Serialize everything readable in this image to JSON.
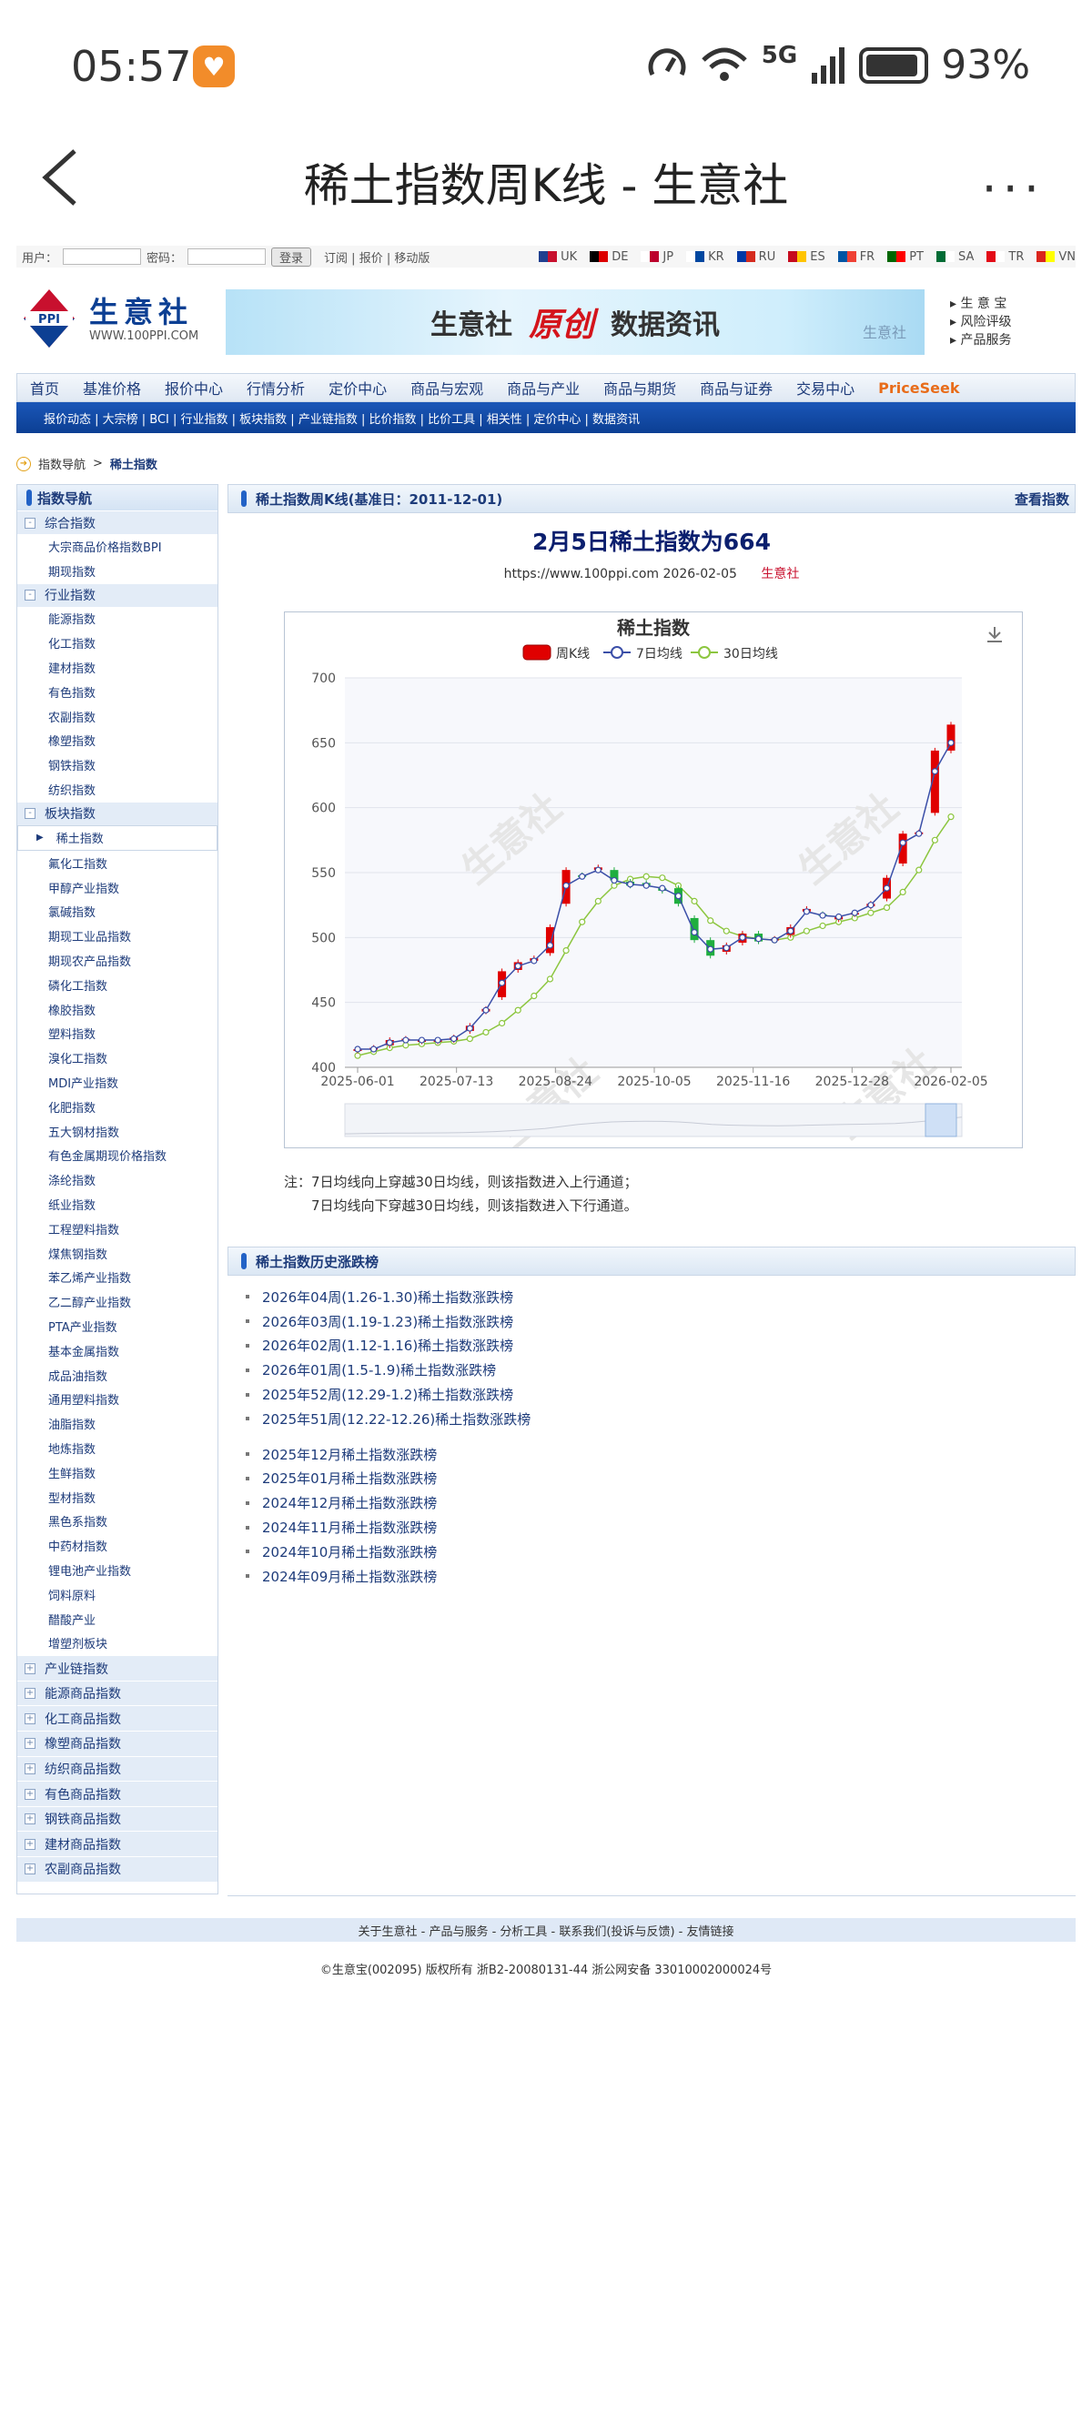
{
  "status": {
    "time": "05:57",
    "network": "5G",
    "battery": "93%"
  },
  "nav": {
    "title": "稀土指数周K线 - 生意社",
    "more": "···"
  },
  "site": {
    "top": {
      "user_label": "用户：",
      "pass_label": "密码：",
      "login": "登录",
      "links": "订阅 | 报价 | 移动版",
      "langs": [
        {
          "code": "UK",
          "c1": "#1f3f8f",
          "c2": "#c8102e"
        },
        {
          "code": "DE",
          "c1": "#000",
          "c2": "#dd0000"
        },
        {
          "code": "JP",
          "c1": "#fff",
          "c2": "#bc002d"
        },
        {
          "code": "KR",
          "c1": "#fff",
          "c2": "#0047a0"
        },
        {
          "code": "RU",
          "c1": "#0039a6",
          "c2": "#d52b1e"
        },
        {
          "code": "ES",
          "c1": "#c60b1e",
          "c2": "#ffc400"
        },
        {
          "code": "FR",
          "c1": "#0055a4",
          "c2": "#ef4135"
        },
        {
          "code": "PT",
          "c1": "#006600",
          "c2": "#ff0000"
        },
        {
          "code": "SA",
          "c1": "#006c35",
          "c2": "#fff"
        },
        {
          "code": "TR",
          "c1": "#e30a17",
          "c2": "#fff"
        },
        {
          "code": "VN",
          "c1": "#da251d",
          "c2": "#ffff00"
        }
      ]
    },
    "logo": {
      "name": "生意社",
      "url": "WWW.100PPI.COM",
      "mark": "PPI"
    },
    "banner": {
      "a": "生意社",
      "b": "原创",
      "c": "数据资讯",
      "d": "生意社"
    },
    "right_links": [
      "生 意 宝",
      "风险评级",
      "产品服务"
    ],
    "menu": [
      "首页",
      "基准价格",
      "报价中心",
      "行情分析",
      "定价中心",
      "商品与宏观",
      "商品与产业",
      "商品与期货",
      "商品与证券",
      "交易中心",
      "PriceSeek"
    ],
    "submenu": "报价动态 | 大宗榜 | BCI | 行业指数 | 板块指数 | 产业链指数 | 比价指数 | 比价工具 | 相关性 | 定价中心 | 数据资讯",
    "crumb": {
      "a": "指数导航",
      "sep": ">",
      "b": "稀土指数"
    }
  },
  "sidebar": {
    "title": "指数导航",
    "groups": [
      {
        "label": "综合指数",
        "items": [
          "大宗商品价格指数BPI",
          "期现指数"
        ]
      },
      {
        "label": "行业指数",
        "items": [
          "能源指数",
          "化工指数",
          "建材指数",
          "有色指数",
          "农副指数",
          "橡塑指数",
          "钢铁指数",
          "纺织指数"
        ]
      },
      {
        "label": "板块指数",
        "active": "稀土指数",
        "items": [
          "氟化工指数",
          "甲醇产业指数",
          "氯碱指数",
          "期现工业品指数",
          "期现农产品指数",
          "磷化工指数",
          "橡胶指数",
          "塑料指数",
          "溴化工指数",
          "MDI产业指数",
          "化肥指数",
          "五大钢材指数",
          "有色金属期现价格指数",
          "涤纶指数",
          "纸业指数",
          "工程塑料指数",
          "煤焦钢指数",
          "苯乙烯产业指数",
          "乙二醇产业指数",
          "PTA产业指数",
          "基本金属指数",
          "成品油指数",
          "通用塑料指数",
          "油脂指数",
          "地炼指数",
          "生鲜指数",
          "型材指数",
          "黑色系指数",
          "中药材指数",
          "锂电池产业指数",
          "饲料原料",
          "醋酸产业",
          "增塑剂板块"
        ]
      }
    ],
    "collapsed": [
      "产业链指数",
      "能源商品指数",
      "化工商品指数",
      "橡塑商品指数",
      "纺织商品指数",
      "有色商品指数",
      "钢铁商品指数",
      "建材商品指数",
      "农副商品指数"
    ]
  },
  "main": {
    "head": "稀土指数周K线(基准日：2011-12-01)",
    "head_link": "查看指数",
    "headline": "2月5日稀土指数为664",
    "source": "https://www.100ppi.com 2026-02-05",
    "source_brand": "生意社",
    "note1": "注：7日均线向上穿越30日均线，则该指数进入上行通道；",
    "note2": "7日均线向下穿越30日均线，则该指数进入下行通道。",
    "hist_head": "稀土指数历史涨跌榜",
    "hist_week": [
      "2026年04周(1.26-1.30)稀土指数涨跌榜",
      "2026年03周(1.19-1.23)稀土指数涨跌榜",
      "2026年02周(1.12-1.16)稀土指数涨跌榜",
      "2026年01周(1.5-1.9)稀土指数涨跌榜",
      "2025年52周(12.29-1.2)稀土指数涨跌榜",
      "2025年51周(12.22-12.26)稀土指数涨跌榜"
    ],
    "hist_month": [
      "2025年12月稀土指数涨跌榜",
      "2025年01月稀土指数涨跌榜",
      "2024年12月稀土指数涨跌榜",
      "2024年11月稀土指数涨跌榜",
      "2024年10月稀土指数涨跌榜",
      "2024年09月稀土指数涨跌榜"
    ]
  },
  "footer": {
    "links": "关于生意社 - 产品与服务 - 分析工具 - 联系我们(投诉与反馈) - 友情链接",
    "copy": "©生意宝(002095) 版权所有 浙B2-20080131-44  浙公网安备 33010002000024号"
  },
  "chart_data": {
    "type": "line",
    "title": "稀土指数",
    "legend": [
      "周K线",
      "7日均线",
      "30日均线"
    ],
    "legend_position": "top",
    "watermark": "生意社",
    "ylim": [
      400,
      700
    ],
    "yticks": [
      400,
      450,
      500,
      550,
      600,
      650,
      700
    ],
    "xticks": [
      "2025-06-01",
      "2025-07-13",
      "2025-08-24",
      "2025-10-05",
      "2025-11-16",
      "2025-12-28",
      "2026-02-05"
    ],
    "colors": {
      "up": "#e00000",
      "down": "#1fae3f",
      "ma7": "#3b4fa8",
      "ma30": "#8cc63f"
    },
    "candles": [
      {
        "o": 413,
        "c": 414
      },
      {
        "o": 414,
        "c": 415
      },
      {
        "o": 417,
        "c": 421
      },
      {
        "o": 421,
        "c": 422
      },
      {
        "o": 420,
        "c": 421
      },
      {
        "o": 420,
        "c": 421
      },
      {
        "o": 421,
        "c": 423
      },
      {
        "o": 428,
        "c": 432
      },
      {
        "o": 443,
        "c": 445
      },
      {
        "o": 454,
        "c": 474
      },
      {
        "o": 475,
        "c": 481
      },
      {
        "o": 482,
        "c": 484
      },
      {
        "o": 488,
        "c": 508
      },
      {
        "o": 526,
        "c": 552
      },
      {
        "o": 548,
        "c": 547
      },
      {
        "o": 552,
        "c": 554
      },
      {
        "o": 552,
        "c": 544
      },
      {
        "o": 543,
        "c": 540
      },
      {
        "o": 542,
        "c": 540
      },
      {
        "o": 538,
        "c": 536
      },
      {
        "o": 538,
        "c": 526
      },
      {
        "o": 515,
        "c": 498
      },
      {
        "o": 498,
        "c": 486
      },
      {
        "o": 489,
        "c": 494
      },
      {
        "o": 496,
        "c": 503
      },
      {
        "o": 503,
        "c": 497
      },
      {
        "o": 498,
        "c": 499
      },
      {
        "o": 502,
        "c": 508
      },
      {
        "o": 520,
        "c": 522
      },
      {
        "o": 518,
        "c": 517
      },
      {
        "o": 514,
        "c": 516
      },
      {
        "o": 518,
        "c": 519
      },
      {
        "o": 524,
        "c": 526
      },
      {
        "o": 530,
        "c": 546
      },
      {
        "o": 557,
        "c": 580
      },
      {
        "o": 580,
        "c": 581
      },
      {
        "o": 596,
        "c": 644
      },
      {
        "o": 644,
        "c": 664
      }
    ],
    "ma7": [
      414,
      414,
      419,
      421,
      421,
      421,
      422,
      430,
      444,
      465,
      478,
      482,
      494,
      540,
      547,
      552,
      544,
      541,
      540,
      538,
      532,
      504,
      491,
      492,
      500,
      499,
      498,
      505,
      520,
      517,
      516,
      519,
      525,
      538,
      573,
      580,
      628,
      650
    ],
    "ma30": [
      409,
      412,
      415,
      417,
      418,
      419,
      420,
      422,
      427,
      434,
      444,
      455,
      468,
      490,
      512,
      528,
      540,
      545,
      547,
      546,
      540,
      528,
      513,
      505,
      501,
      499,
      498,
      500,
      505,
      509,
      512,
      515,
      519,
      523,
      535,
      552,
      575,
      593
    ]
  }
}
